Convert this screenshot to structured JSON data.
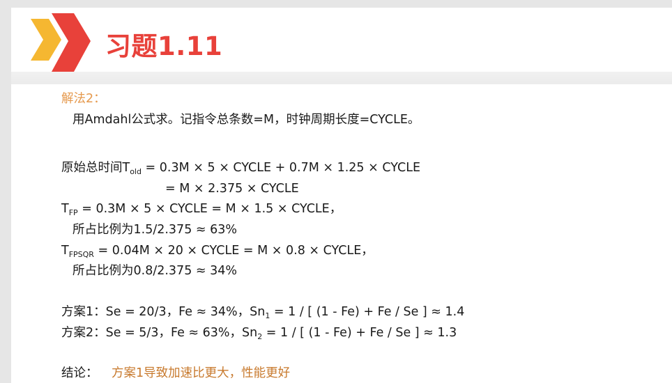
{
  "title": "习题1.11",
  "method_label": "解法2：",
  "intro": "用Amdahl公式求。记指令总条数=M，时钟周期长度=CYCLE。",
  "told": {
    "prefix": "原始总时间T",
    "sub": "old",
    "expr": " = 0.3M × 5 × CYCLE + 0.7M × 1.25 × CYCLE",
    "cont": "= M × 2.375 × CYCLE"
  },
  "tfp": {
    "prefix": "T",
    "sub": "FP",
    "expr": " = 0.3M × 5 × CYCLE = M × 1.5 × CYCLE，",
    "ratio": "所占比例为1.5/2.375 ≈ 63%"
  },
  "tfpsqr": {
    "prefix": "T",
    "sub": "FPSQR",
    "expr": " = 0.04M × 20 × CYCLE = M × 0.8 × CYCLE，",
    "ratio": "所占比例为0.8/2.375 ≈ 34%"
  },
  "plan1": {
    "text": "方案1：Se = 20/3，Fe ≈ 34%，Sn",
    "sub": "1",
    "expr": " = 1 / [ (1 - Fe) + Fe / Se ] ≈ 1.4"
  },
  "plan2": {
    "text": "方案2：Se = 5/3，Fe ≈ 63%，Sn",
    "sub": "2",
    "expr": " = 1 / [ (1 - Fe) + Fe / Se ] ≈ 1.3"
  },
  "conclusion_label": "结论：",
  "conclusion_text": "方案1导致加速比更大，性能更好",
  "colors": {
    "title": "#e8413a",
    "chevron_yellow": "#f5b731",
    "chevron_red": "#e8413a",
    "method_label": "#e5994d",
    "conclusion": "#c87a2e"
  },
  "icons": [
    "double-chevron-icon"
  ]
}
